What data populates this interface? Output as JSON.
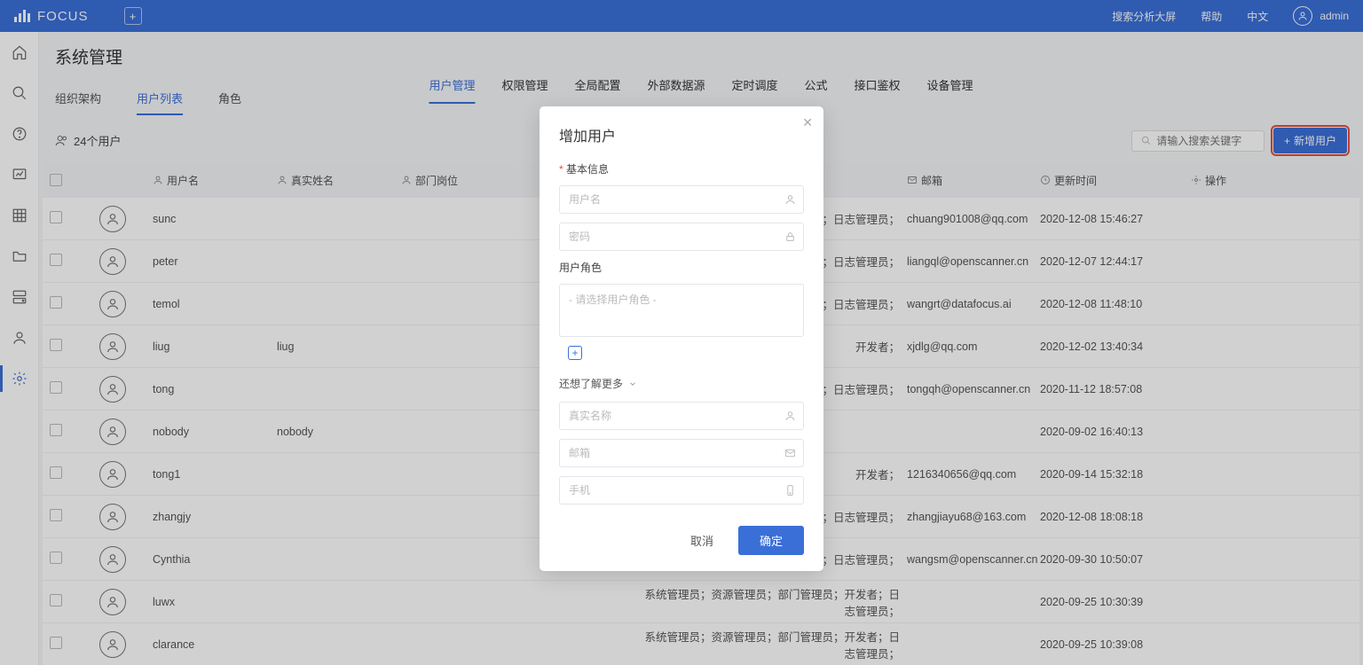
{
  "brand": "FOCUS",
  "top_right": {
    "dashboard": "搜索分析大屏",
    "help": "帮助",
    "lang": "中文",
    "user": "admin"
  },
  "page_title": "系统管理",
  "top_tabs": [
    "用户管理",
    "权限管理",
    "全局配置",
    "外部数据源",
    "定时调度",
    "公式",
    "接口鉴权",
    "设备管理"
  ],
  "top_tab_active": 0,
  "sub_tabs": [
    "组织架构",
    "用户列表",
    "角色"
  ],
  "sub_tab_active": 1,
  "count_label": "24个用户",
  "search_placeholder": "请输入搜索关键字",
  "add_button": "新增用户",
  "columns": {
    "username": "用户名",
    "realname": "真实姓名",
    "dept": "部门岗位",
    "roles_hidden": "",
    "email": "邮箱",
    "updated": "更新时间",
    "ops": "操作"
  },
  "rows": [
    {
      "username": "sunc",
      "realname": "",
      "dept": "",
      "roles": "开发者；日志管理员；",
      "email": "chuang901008@qq.com",
      "updated": "2020-12-08 15:46:27"
    },
    {
      "username": "peter",
      "realname": "",
      "dept": "",
      "roles": "开发者；日志管理员；",
      "email": "liangql@openscanner.cn",
      "updated": "2020-12-07 12:44:17"
    },
    {
      "username": "temol",
      "realname": "",
      "dept": "",
      "roles": "开发者；日志管理员；",
      "email": "wangrt@datafocus.ai",
      "updated": "2020-12-08 11:48:10"
    },
    {
      "username": "liug",
      "realname": "liug",
      "dept": "",
      "roles": "开发者；",
      "email": "xjdlg@qq.com",
      "updated": "2020-12-02 13:40:34"
    },
    {
      "username": "tong",
      "realname": "",
      "dept": "",
      "roles": "开发者；日志管理员；",
      "email": "tongqh@openscanner.cn",
      "updated": "2020-11-12 18:57:08"
    },
    {
      "username": "nobody",
      "realname": "nobody",
      "dept": "",
      "roles": "",
      "email": "",
      "updated": "2020-09-02 16:40:13"
    },
    {
      "username": "tong1",
      "realname": "",
      "dept": "",
      "roles": "开发者；",
      "email": "1216340656@qq.com",
      "updated": "2020-09-14 15:32:18"
    },
    {
      "username": "zhangjy",
      "realname": "",
      "dept": "",
      "roles": "开发者；日志管理员；",
      "email": "zhangjiayu68@163.com",
      "updated": "2020-12-08 18:08:18"
    },
    {
      "username": "Cynthia",
      "realname": "",
      "dept": "",
      "roles": "开发者；日志管理员；",
      "email": "wangsm@openscanner.cn",
      "updated": "2020-09-30 10:50:07"
    },
    {
      "username": "luwx",
      "realname": "",
      "dept": "",
      "roles": "系统管理员；资源管理员；部门管理员；开发者；日志管理员；",
      "email": "",
      "updated": "2020-09-25 10:30:39"
    },
    {
      "username": "clarance",
      "realname": "",
      "dept": "",
      "roles": "系统管理员；资源管理员；部门管理员；开发者；日志管理员；",
      "email": "",
      "updated": "2020-09-25 10:39:08"
    }
  ],
  "modal": {
    "title": "增加用户",
    "basic_section": "基本信息",
    "username_ph": "用户名",
    "password_ph": "密码",
    "role_section": "用户角色",
    "role_select_ph": "- 请选择用户角色 -",
    "more_section": "还想了解更多",
    "realname_ph": "真实名称",
    "email_ph": "邮箱",
    "phone_ph": "手机",
    "cancel": "取消",
    "ok": "确定"
  }
}
